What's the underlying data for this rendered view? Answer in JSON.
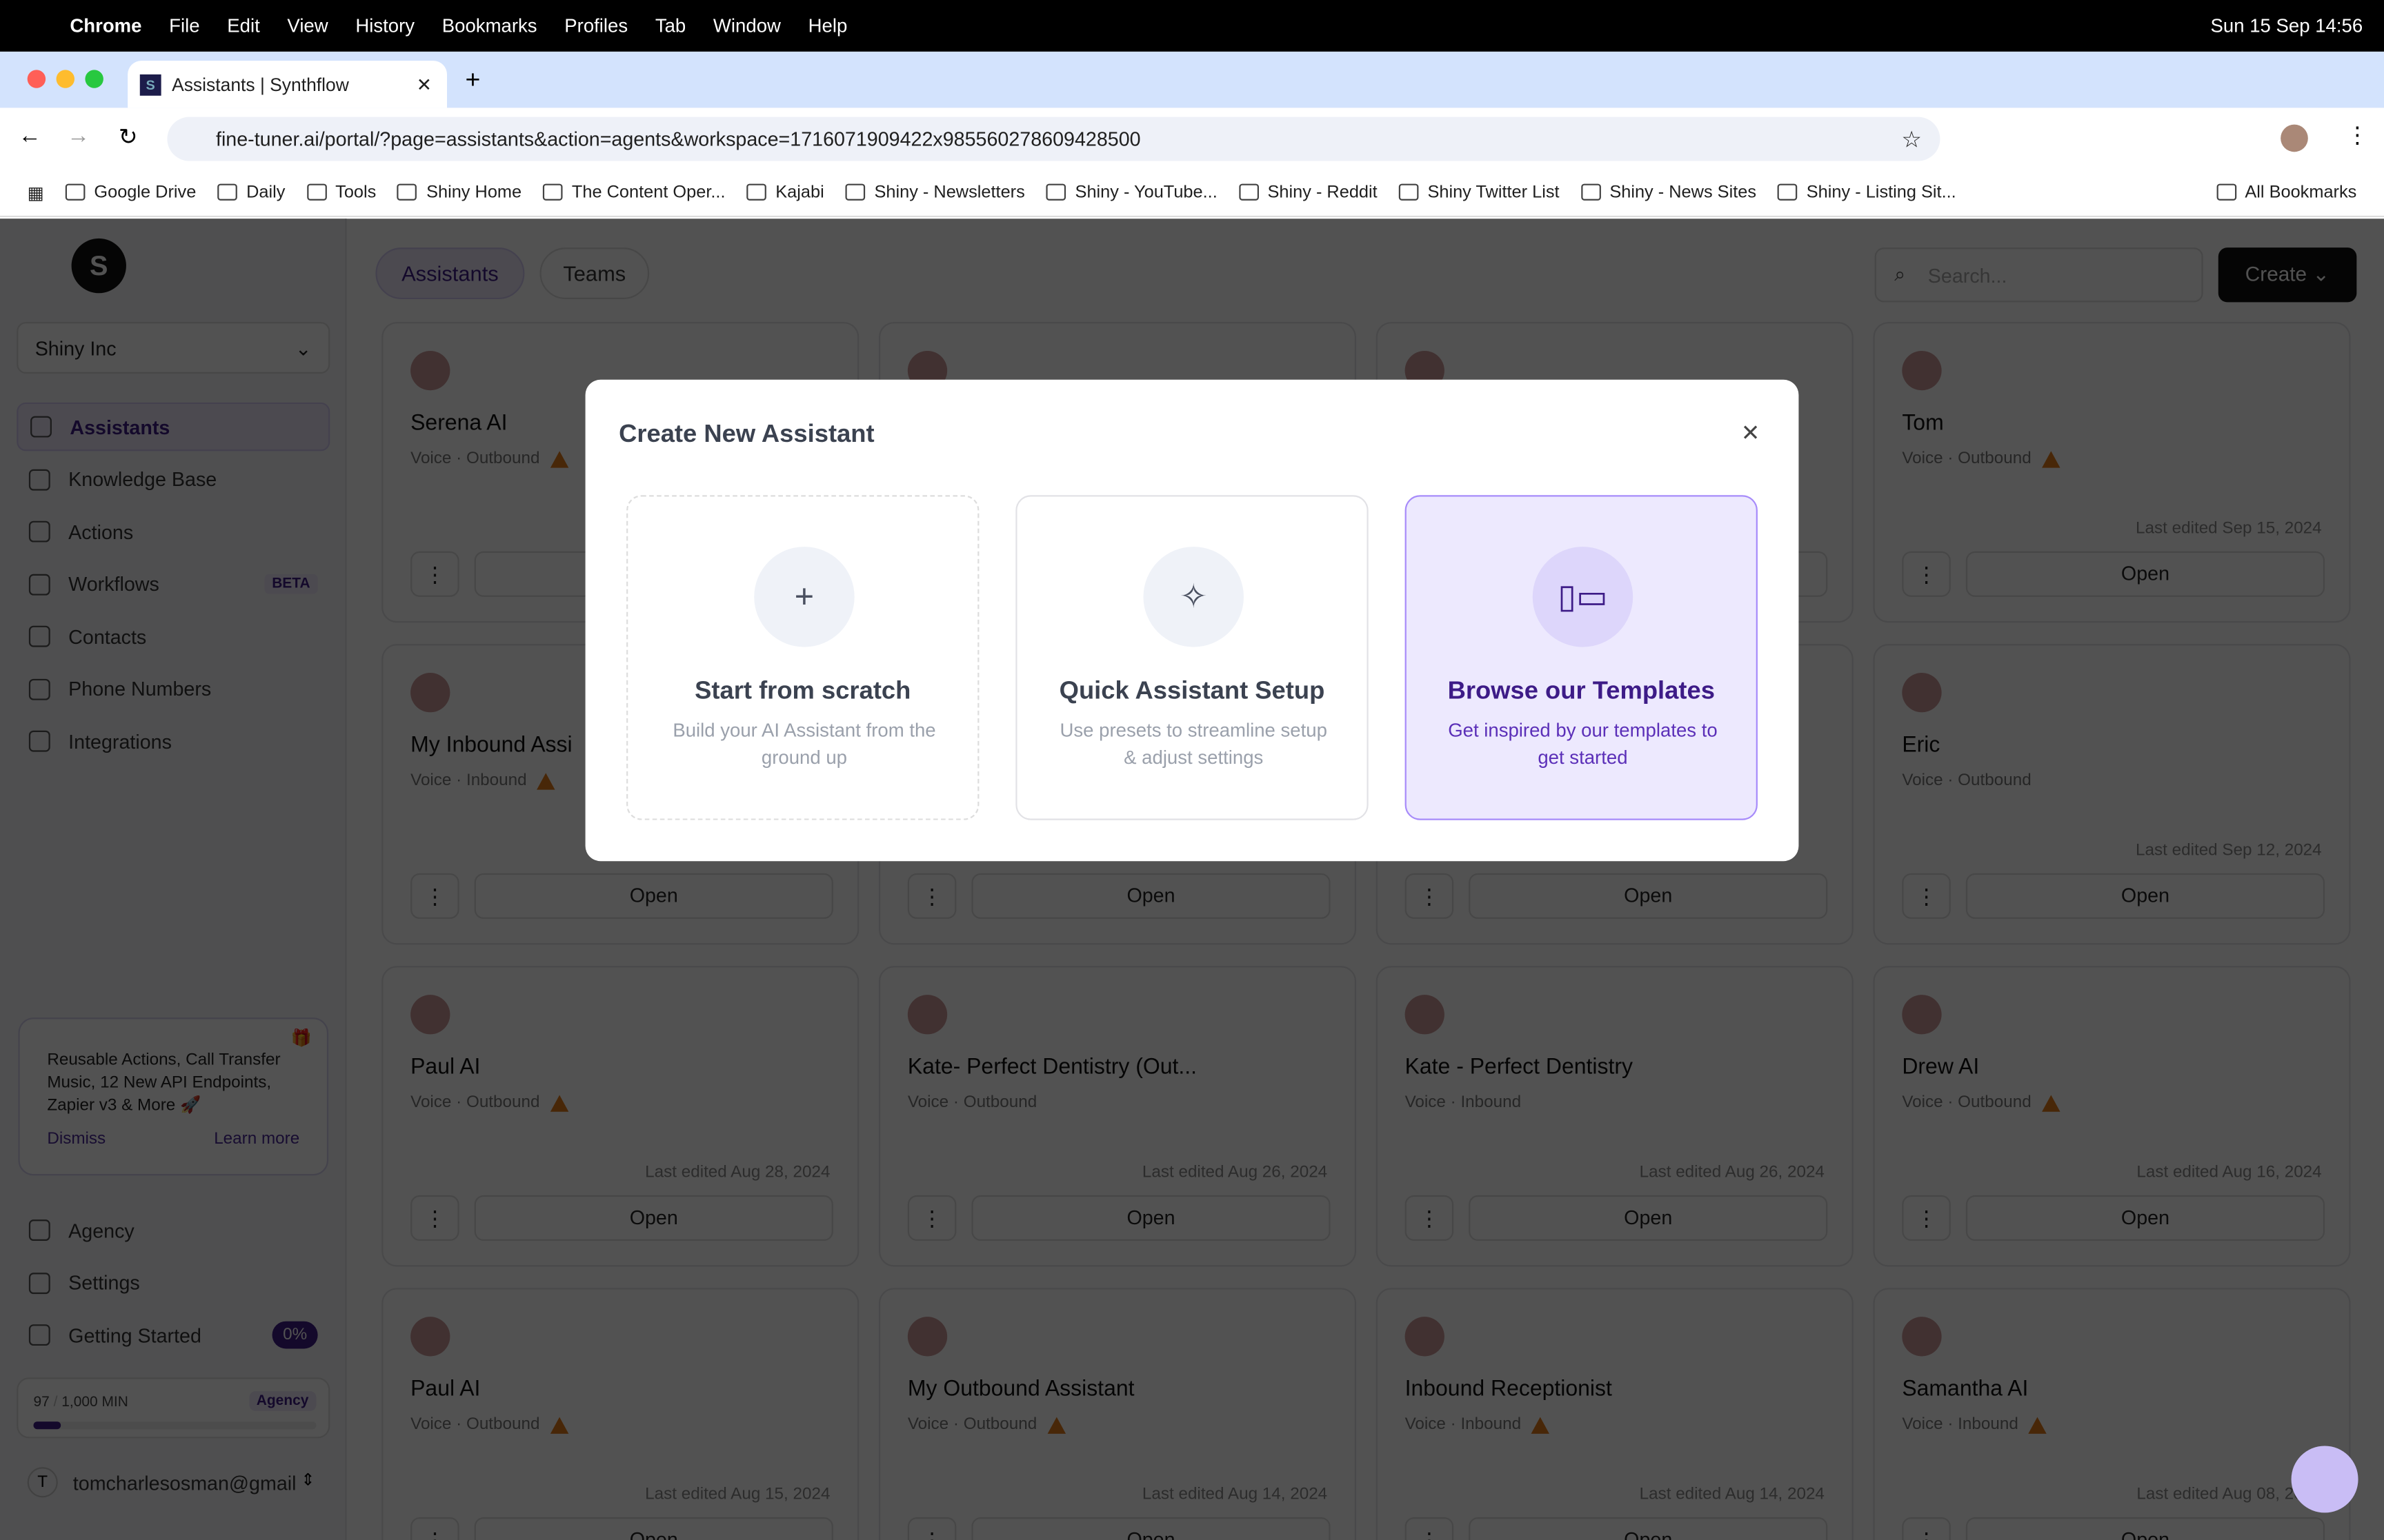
{
  "menubar": {
    "app": "Chrome",
    "items": [
      "File",
      "Edit",
      "View",
      "History",
      "Bookmarks",
      "Profiles",
      "Tab",
      "Window",
      "Help"
    ],
    "clock": "Sun 15 Sep  14:56"
  },
  "browser": {
    "tab_title": "Assistants | Synthflow",
    "url": "fine-tuner.ai/portal/?page=assistants&action=agents&workspace=1716071909422x985560278609428500",
    "bookmarks": [
      "Google Drive",
      "Daily",
      "Tools",
      "Shiny Home",
      "The Content Oper...",
      "Kajabi",
      "Shiny - Newsletters",
      "Shiny - YouTube...",
      "Shiny - Reddit",
      "Shiny Twitter List",
      "Shiny - News Sites",
      "Shiny - Listing Sit..."
    ],
    "all_bookmarks": "All Bookmarks"
  },
  "sidebar": {
    "workspace": "Shiny Inc",
    "items": [
      {
        "label": "Assistants",
        "icon": "user-plus-icon"
      },
      {
        "label": "Knowledge Base",
        "icon": "graduation-cap-icon"
      },
      {
        "label": "Actions",
        "icon": "tools-icon"
      },
      {
        "label": "Workflows",
        "icon": "bolt-icon",
        "badge": "BETA"
      },
      {
        "label": "Contacts",
        "icon": "address-card-icon"
      },
      {
        "label": "Phone Numbers",
        "icon": "phone-icon"
      },
      {
        "label": "Integrations",
        "icon": "puzzle-icon"
      }
    ],
    "announcement": {
      "text": "Reusable Actions, Call Transfer Music, 12 New API Endpoints, Zapier v3 & More 🚀",
      "dismiss": "Dismiss",
      "learn_more": "Learn more"
    },
    "bottom_items": [
      {
        "label": "Agency",
        "icon": "building-icon"
      },
      {
        "label": "Settings",
        "icon": "gear-icon"
      },
      {
        "label": "Getting Started",
        "icon": "rocket-icon",
        "badge": "0%"
      }
    ],
    "usage": {
      "used": "97",
      "separator": "/",
      "total": "1,000 MIN",
      "plan": "Agency",
      "fraction": 0.097
    },
    "user": {
      "initial": "T",
      "email": "tomcharlesosman@gmail"
    }
  },
  "header": {
    "tabs": [
      "Assistants",
      "Teams"
    ],
    "search_placeholder": "Search...",
    "create": "Create"
  },
  "cards": [
    {
      "name": "Serena AI",
      "sub": "Voice · Outbound",
      "warn": true,
      "edited": ""
    },
    {
      "name": "",
      "sub": "",
      "warn": false,
      "edited": ""
    },
    {
      "name": "",
      "sub": "",
      "warn": false,
      "edited": ""
    },
    {
      "name": "Tom",
      "sub": "Voice · Outbound",
      "warn": true,
      "edited": "Last edited Sep 15, 2024"
    },
    {
      "name": "My Inbound Assi",
      "sub": "Voice · Inbound",
      "warn": true,
      "edited": ""
    },
    {
      "name": "",
      "sub": "",
      "warn": false,
      "edited": ""
    },
    {
      "name": "",
      "sub": "",
      "warn": false,
      "edited": ""
    },
    {
      "name": "Eric",
      "sub": "Voice · Outbound",
      "warn": false,
      "edited": "Last edited Sep 12, 2024"
    },
    {
      "name": "Paul AI",
      "sub": "Voice · Outbound",
      "warn": true,
      "edited": "Last edited Aug 28, 2024"
    },
    {
      "name": "Kate- Perfect Dentistry (Out...",
      "sub": "Voice · Outbound",
      "warn": false,
      "edited": "Last edited Aug 26, 2024"
    },
    {
      "name": "Kate - Perfect Dentistry",
      "sub": "Voice · Inbound",
      "warn": false,
      "edited": "Last edited Aug 26, 2024"
    },
    {
      "name": "Drew AI",
      "sub": "Voice · Outbound",
      "warn": true,
      "edited": "Last edited Aug 16, 2024"
    },
    {
      "name": "Paul AI",
      "sub": "Voice · Outbound",
      "warn": true,
      "edited": "Last edited Aug 15, 2024"
    },
    {
      "name": "My Outbound Assistant",
      "sub": "Voice · Outbound",
      "warn": true,
      "edited": "Last edited Aug 14, 2024"
    },
    {
      "name": "Inbound Receptionist",
      "sub": "Voice · Inbound",
      "warn": true,
      "edited": "Last edited Aug 14, 2024"
    },
    {
      "name": "Samantha AI",
      "sub": "Voice · Inbound",
      "warn": true,
      "edited": "Last edited Aug 08, 2024"
    }
  ],
  "card_open": "Open",
  "modal": {
    "title": "Create New Assistant",
    "options": [
      {
        "title": "Start from scratch",
        "desc": "Build your AI Assistant from the ground up",
        "icon": "plus-icon"
      },
      {
        "title": "Quick Assistant Setup",
        "desc": "Use presets to streamline setup & adjust settings",
        "icon": "sparkles-icon"
      },
      {
        "title": "Browse our Templates",
        "desc": "Get inspired by our templates to get started",
        "icon": "layout-icon"
      }
    ]
  },
  "colors": {
    "accent": "#3d1b87",
    "template_bg": "#ede9fe",
    "template_border": "#a78bfa",
    "warning": "#e07b1a"
  }
}
